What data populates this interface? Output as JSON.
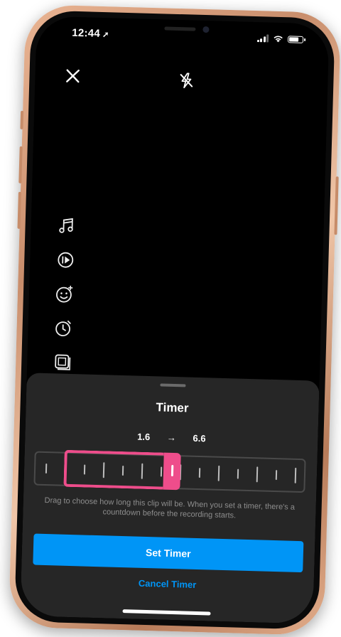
{
  "status_bar": {
    "time": "12:44",
    "location_arrow": "location-arrow-icon"
  },
  "header": {
    "close_icon": "close-icon",
    "flash_icon": "flash-off-icon"
  },
  "side_tools": [
    {
      "name": "music-icon"
    },
    {
      "name": "speed-icon"
    },
    {
      "name": "effects-icon"
    },
    {
      "name": "timer-icon"
    },
    {
      "name": "layout-icon"
    }
  ],
  "sheet": {
    "title": "Timer",
    "range": {
      "start": "1.6",
      "arrow": "→",
      "end": "6.6"
    },
    "selection": {
      "start_fraction": 0.105,
      "end_fraction": 0.475
    },
    "helper_text": "Drag to choose how long this clip will be. When you set a timer, there's a countdown before the recording starts.",
    "set_button": "Set Timer",
    "cancel_button": "Cancel Timer"
  },
  "colors": {
    "accent_pink": "#ee4d8b",
    "primary_blue": "#0095f6",
    "sheet_background": "#262626",
    "phone_frame": "#d9a07d"
  }
}
